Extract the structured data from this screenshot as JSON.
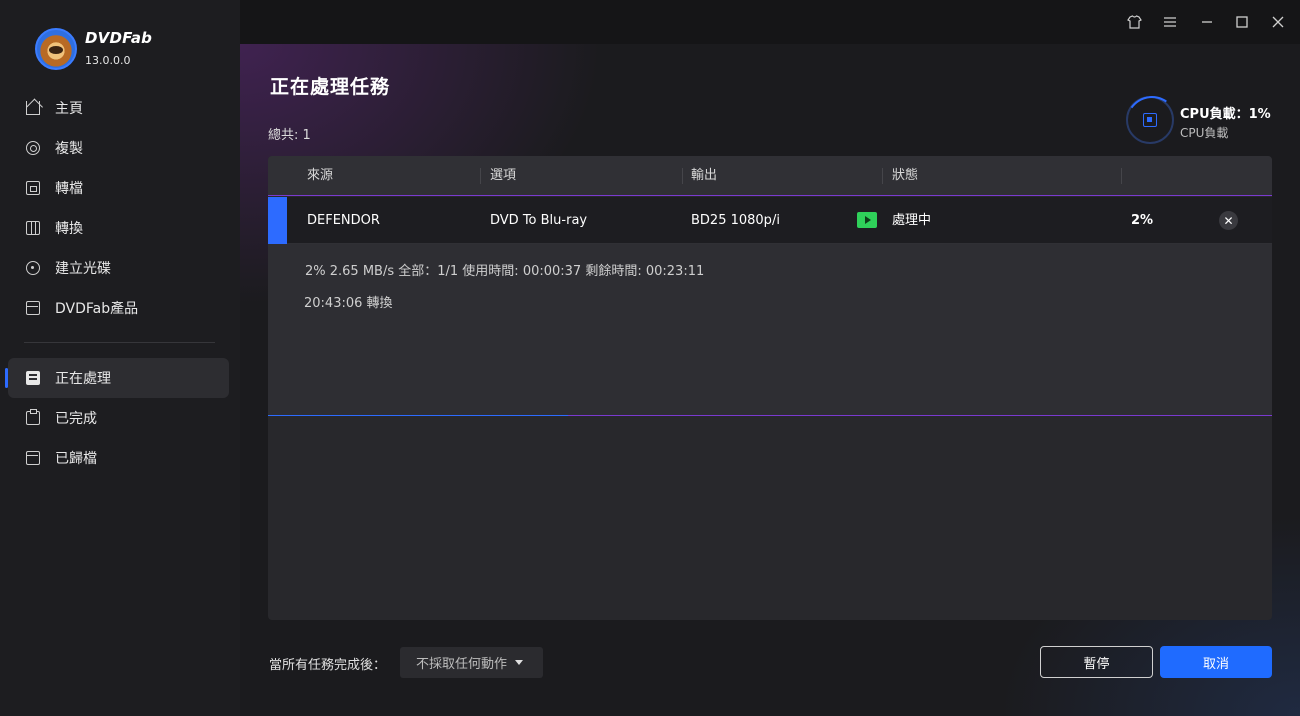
{
  "app": {
    "brand": "DVDFab",
    "version": "13.0.0.0"
  },
  "sidebar": {
    "items": [
      {
        "label": "主頁",
        "icon": "home-icon"
      },
      {
        "label": "複製",
        "icon": "copy-icon"
      },
      {
        "label": "轉檔",
        "icon": "ripper-icon"
      },
      {
        "label": "轉換",
        "icon": "converter-icon"
      },
      {
        "label": "建立光碟",
        "icon": "disc-icon"
      },
      {
        "label": "DVDFab產品",
        "icon": "products-icon"
      }
    ],
    "queue_items": [
      {
        "label": "正在處理",
        "icon": "processing-icon",
        "active": true
      },
      {
        "label": "已完成",
        "icon": "finished-icon"
      },
      {
        "label": "已歸檔",
        "icon": "archived-icon"
      }
    ]
  },
  "window_controls": [
    "skin-icon",
    "menu-icon",
    "minimize-icon",
    "maximize-icon",
    "close-icon"
  ],
  "main": {
    "title": "正在處理任務",
    "total": "總共: 1",
    "cpu": {
      "title": "CPU負載：1%",
      "subtitle": "CPU負載",
      "value_percent": 1
    },
    "table": {
      "columns": [
        "來源",
        "選項",
        "輸出",
        "狀態"
      ],
      "rows": [
        {
          "source": "DEFENDOR",
          "option": "DVD To Blu-ray",
          "output": "BD25 1080p/i",
          "status": "處理中",
          "progress": "2%"
        }
      ]
    },
    "detail": {
      "line1": "2%  2.65 MB/s   全部：1/1  使用時間:  00:00:37  剩餘時間:  00:23:11",
      "line2": "20:43:06  轉換"
    },
    "footer": {
      "after_label": "當所有任務完成後：",
      "after_value": "不採取任何動作",
      "pause_label": "暫停",
      "cancel_label": "取消"
    }
  },
  "colors": {
    "accent": "#1f6bff",
    "status_green": "#2fd05a",
    "divider_purple": "#7a3ad0"
  }
}
